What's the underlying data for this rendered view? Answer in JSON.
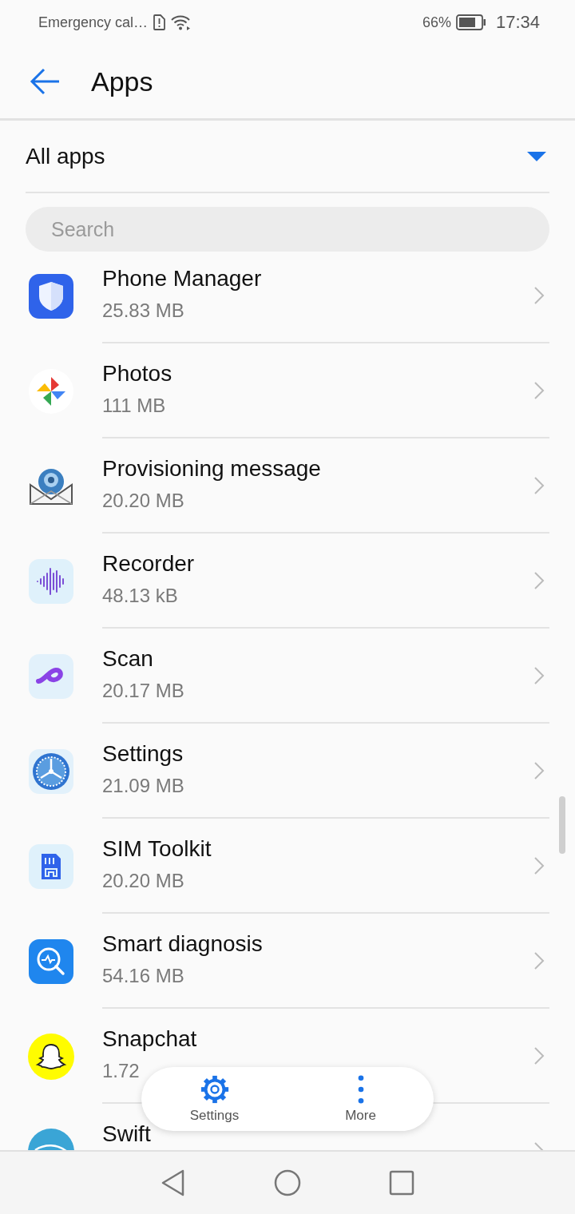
{
  "status_bar": {
    "carrier": "Emergency cal…",
    "battery_percent": "66%",
    "time": "17:34"
  },
  "header": {
    "title": "Apps"
  },
  "filter": {
    "label": "All apps"
  },
  "search": {
    "placeholder": "Search"
  },
  "apps": [
    {
      "name": "Phone Manager",
      "size": "25.83 MB"
    },
    {
      "name": "Photos",
      "size": "111 MB"
    },
    {
      "name": "Provisioning message",
      "size": "20.20 MB"
    },
    {
      "name": "Recorder",
      "size": "48.13 kB"
    },
    {
      "name": "Scan",
      "size": "20.17 MB"
    },
    {
      "name": "Settings",
      "size": "21.09 MB"
    },
    {
      "name": "SIM Toolkit",
      "size": "20.20 MB"
    },
    {
      "name": "Smart diagnosis",
      "size": "54.16 MB"
    },
    {
      "name": "Snapchat",
      "size": "1.72"
    },
    {
      "name": "Swift"
    }
  ],
  "floating_actions": [
    {
      "label": "Settings",
      "kind": "gear"
    },
    {
      "label": "More",
      "kind": "dots"
    }
  ]
}
